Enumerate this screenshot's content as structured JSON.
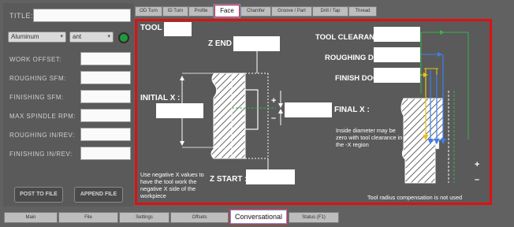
{
  "left_panel": {
    "title_label": "TITLE:",
    "title_value": "",
    "material_select": "Aluminum",
    "units_select": "ant",
    "labels": [
      "WORK OFFSET:",
      "ROUGHING SFM:",
      "FINISHING SFM:",
      "MAX SPINDLE RPM:",
      "ROUGHING IN/REV:",
      "FINISHING IN/REV:"
    ],
    "buttons": [
      "POST TO FILE",
      "APPEND FILE"
    ]
  },
  "top_tabs": [
    "OD Turn",
    "ID Turn",
    "Profile",
    "Face",
    "Chamfer",
    "Groove / Part",
    "Drill / Tap",
    "Thread"
  ],
  "active_top_tab": "Face",
  "face": {
    "tool_label": "TOOL :",
    "z_end_label": "Z END :",
    "initial_x_label": "INITIAL X :",
    "z_start_label": "Z START :",
    "final_x_label": "FINAL X :",
    "tool_clearance_label": "TOOL CLEARANCE",
    "roughing_doc_label": "ROUGHING DOC",
    "finish_doc_label": "FINISH DOC",
    "plus_sign": "+",
    "minus_sign": "–",
    "note_left": "Use negative X values to have the tool work the negative X side of the workpiece",
    "note_right": "Inside diameter may be zero with tool clearance in the -X region",
    "note_bottom": "Tool radius compensation is not used",
    "inputs": {
      "tool": "",
      "z_end": "",
      "initial_x": "",
      "z_start": "",
      "final_x": "",
      "tool_clearance": "",
      "roughing_doc": "",
      "finish_doc": ""
    }
  },
  "bottom_tabs": [
    "Main",
    "File",
    "Settings",
    "Offsets",
    "Conversational",
    "Status (F1)"
  ],
  "active_bottom_tab": "Conversational"
}
